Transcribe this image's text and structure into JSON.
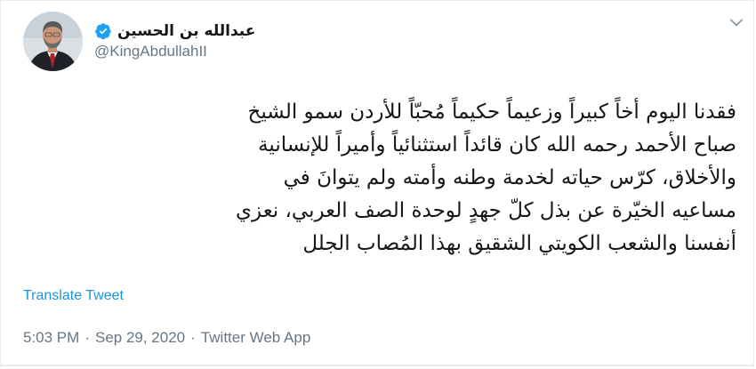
{
  "author": {
    "display_name": "عبدالله بن الحسين",
    "handle": "@KingAbdullahII",
    "verified": true,
    "avatar_icon": "profile-photo"
  },
  "tweet": {
    "text": "فقدنا اليوم أخاً كبيراً وزعيماً حكيماً مُحبّاً للأردن سمو الشيخ\nصباح الأحمد رحمه الله كان قائداً استثنائياً وأميراً للإنسانية\nوالأخلاق، كرّس حياته لخدمة وطنه وأمته ولم يتوانَ في\nمساعيه الخيّرة عن بذل كلّ جهدٍ لوحدة الصف العربي، نعزي\nأنفسنا والشعب الكويتي الشقيق بهذا المُصاب الجلل",
    "translate_label": "Translate Tweet",
    "time": "5:03 PM",
    "separator_1": "·",
    "date": "Sep 29, 2020",
    "separator_2": "·",
    "source": "Twitter Web App"
  },
  "colors": {
    "link": "#1b95e0",
    "muted": "#657786",
    "verified": "#1da1f2",
    "text": "#14171a"
  },
  "icons": {
    "verified": "verified-badge-icon",
    "menu": "chevron-down-icon"
  }
}
